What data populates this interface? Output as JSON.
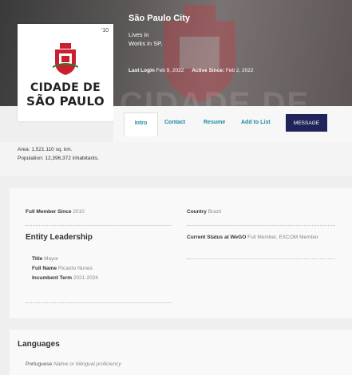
{
  "profile": {
    "name": "São Paulo City",
    "lives_in": "Lives in",
    "works_in": "Works in SP,",
    "last_login_label": "Last Login",
    "last_login_value": "Feb 9, 2022",
    "active_since_label": "Active Since:",
    "active_since_value": "Feb 2, 2022"
  },
  "logo": {
    "year": "'10",
    "line1": "CIDADE DE",
    "line2": "SÃO PAULO"
  },
  "banner": {
    "ghost_text": "CIDADE DE"
  },
  "tabs": {
    "intro": "Intro",
    "contact": "Contact",
    "resume": "Resume",
    "add_to_list": "Add to List",
    "message": "MESSAGE"
  },
  "info": {
    "area": "Area: 1,521.110 sq. km.",
    "population": "Population: 12,396,372 inhabitants."
  },
  "membership": {
    "full_member_label": "Full Member Since",
    "full_member_value": "2010",
    "country_label": "Country",
    "country_value": "Brazil",
    "status_label": "Current Status at WeGO",
    "status_value": "Full Member, EXCOM Member"
  },
  "leadership": {
    "heading": "Entity Leadership",
    "title_label": "Title",
    "title_value": "Mayor",
    "full_name_label": "Full Name",
    "full_name_value": "Ricardo Nunes",
    "term_label": "Incumbent Term",
    "term_value": "2021-2024"
  },
  "languages": {
    "heading": "Languages",
    "language": "Portuguese",
    "proficiency": "Native or bilingual proficiency"
  },
  "colors": {
    "accent": "#1d8aa0",
    "message_button": "#21245a",
    "emblem_red": "#c8202f"
  }
}
